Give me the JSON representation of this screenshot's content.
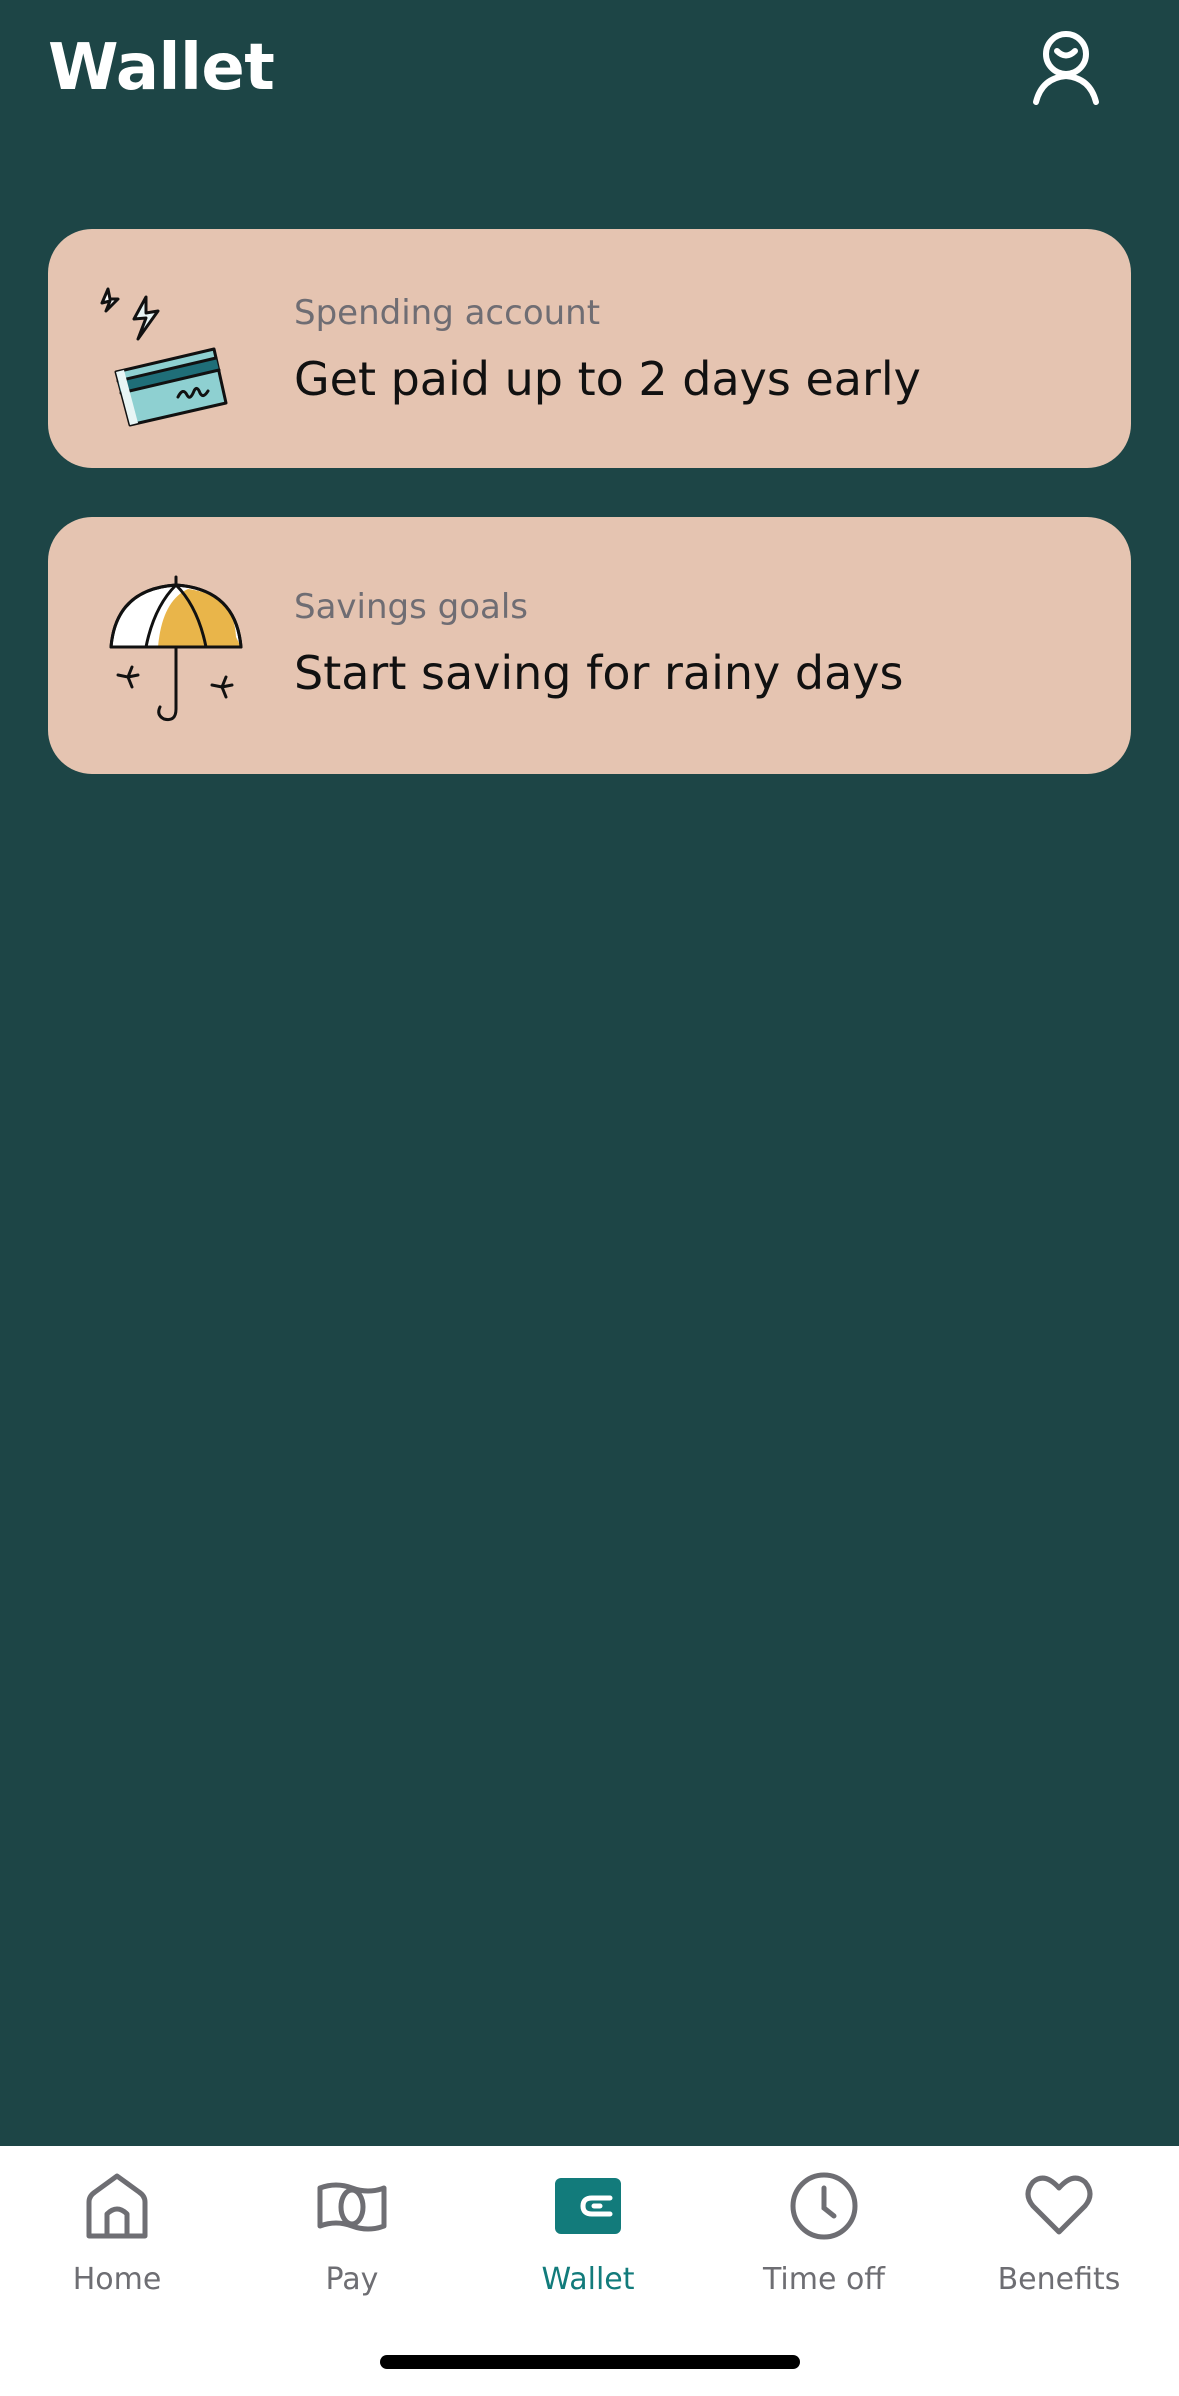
{
  "header": {
    "title": "Wallet",
    "profile_icon": "person-icon"
  },
  "cards": [
    {
      "label": "Spending account",
      "title": "Get paid up to 2 days early",
      "illustration": "credit-card-lightning-illustration"
    },
    {
      "label": "Savings goals",
      "title": "Start saving for rainy days",
      "illustration": "umbrella-illustration"
    }
  ],
  "tabs": [
    {
      "label": "Home",
      "icon": "home-icon",
      "active": false
    },
    {
      "label": "Pay",
      "icon": "money-icon",
      "active": false
    },
    {
      "label": "Wallet",
      "icon": "wallet-icon",
      "active": true
    },
    {
      "label": "Time off",
      "icon": "clock-icon",
      "active": false
    },
    {
      "label": "Benefits",
      "icon": "heart-icon",
      "active": false
    }
  ],
  "colors": {
    "background": "#1d4546",
    "card": "#e5c4b1",
    "active_tab": "#127b7b",
    "inactive_tab": "#6e6e73",
    "illustration_teal": "#8ed0d1",
    "illustration_yellow": "#e9b54a"
  }
}
